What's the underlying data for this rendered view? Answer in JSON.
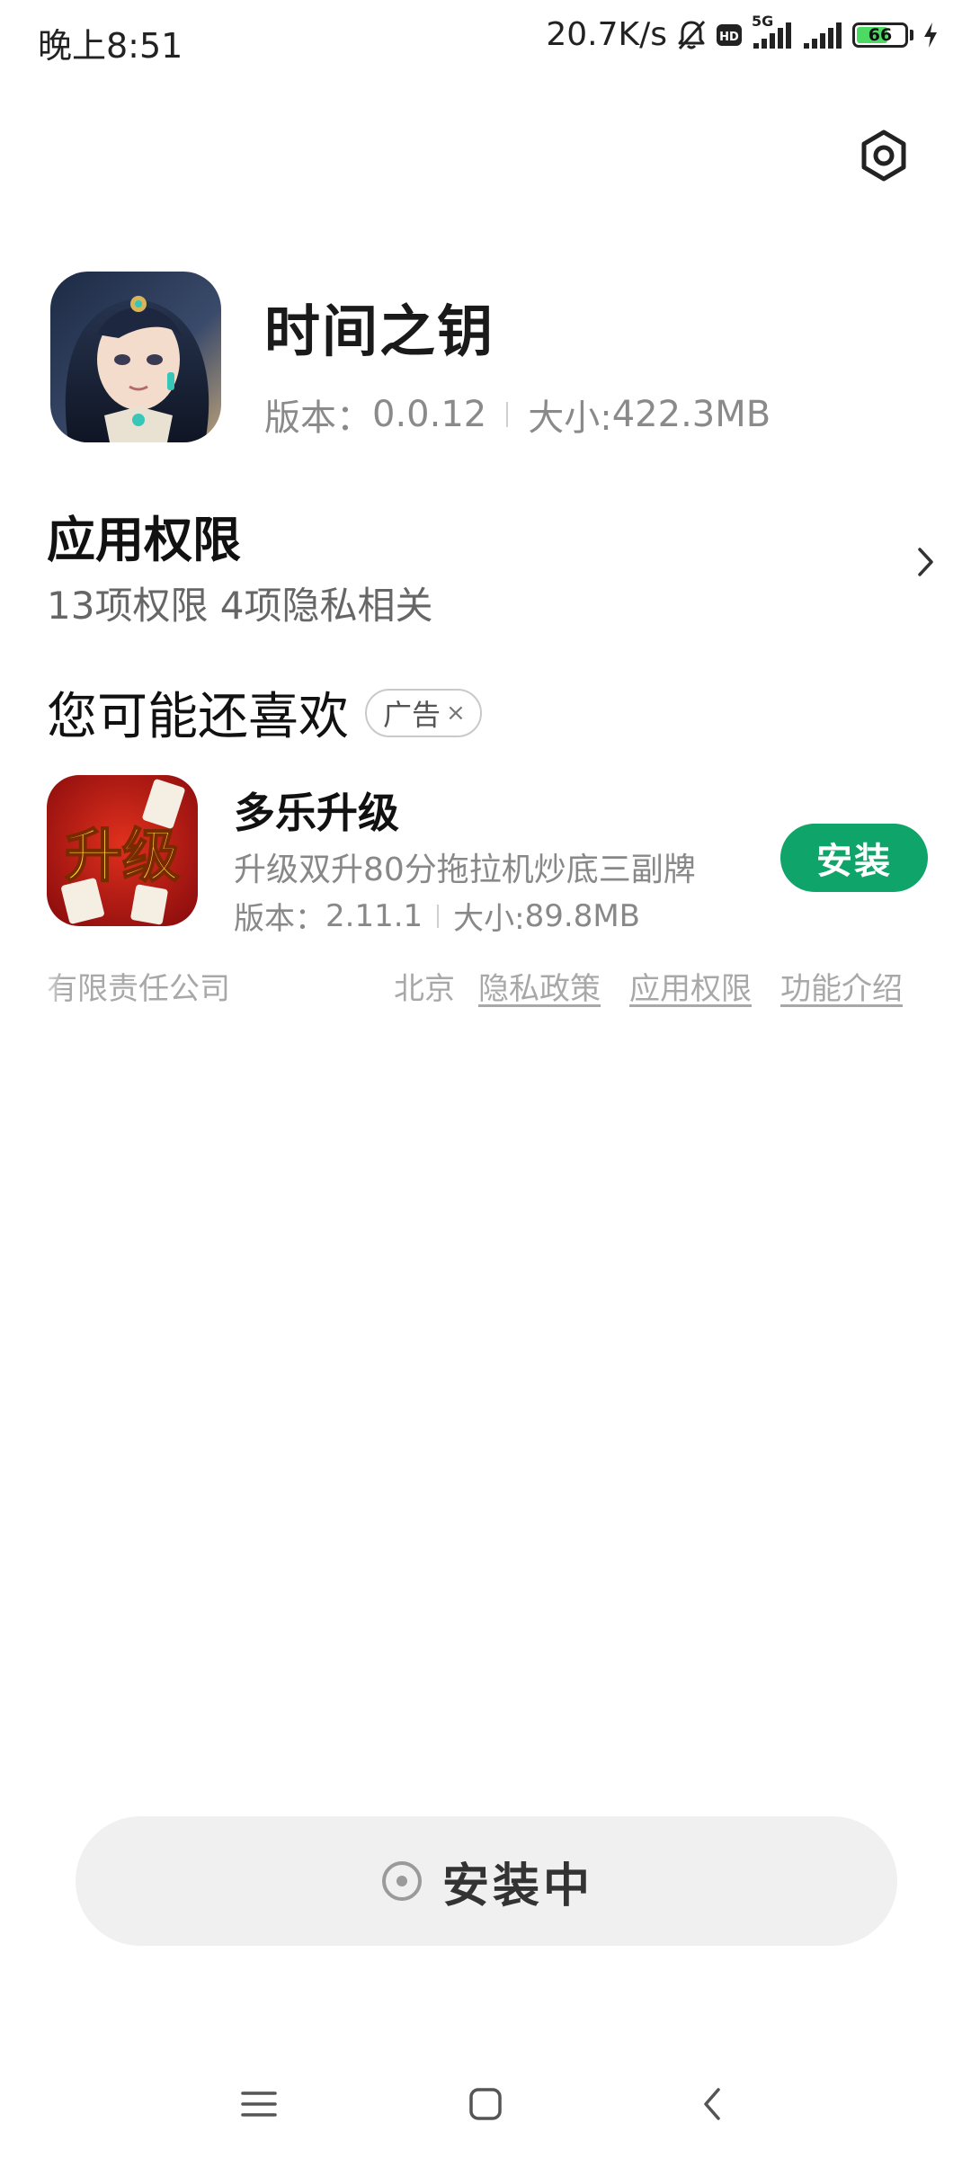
{
  "status_bar": {
    "time": "晚上8:51",
    "speed": "20.7K/s",
    "network": "5G",
    "battery": "66",
    "battery_level": 0.66,
    "battery_color": "#4cd964"
  },
  "header": {
    "settings_icon": "settings-icon"
  },
  "app": {
    "name": "时间之钥",
    "version_label": "版本：",
    "version": "0.0.12",
    "size_label": "大小:",
    "size": "422.3MB"
  },
  "permissions": {
    "title": "应用权限",
    "summary": "13项权限 4项隐私相关"
  },
  "recommend": {
    "title": "您可能还喜欢",
    "ad_label": "广告",
    "ad_close": "×",
    "items": [
      {
        "name": "多乐升级",
        "icon_text": "升级",
        "description": "升级双升80分拖拉机炒底三副牌",
        "version_label": "版本：",
        "version": "2.11.1",
        "size_label": "大小:",
        "size": "89.8MB",
        "install_label": "安装"
      }
    ]
  },
  "footer": {
    "company": "有限责任公司",
    "city": "北京",
    "links": [
      "隐私政策",
      "应用权限",
      "功能介绍"
    ]
  },
  "install_status": {
    "label": "安装中"
  },
  "colors": {
    "accent_green": "#0ea46a",
    "muted_text": "#888888",
    "install_bar_bg": "#f0f0f0"
  },
  "nav_bar": {
    "menu_icon": "menu-icon",
    "home_icon": "home-icon",
    "back_icon": "back-icon"
  }
}
